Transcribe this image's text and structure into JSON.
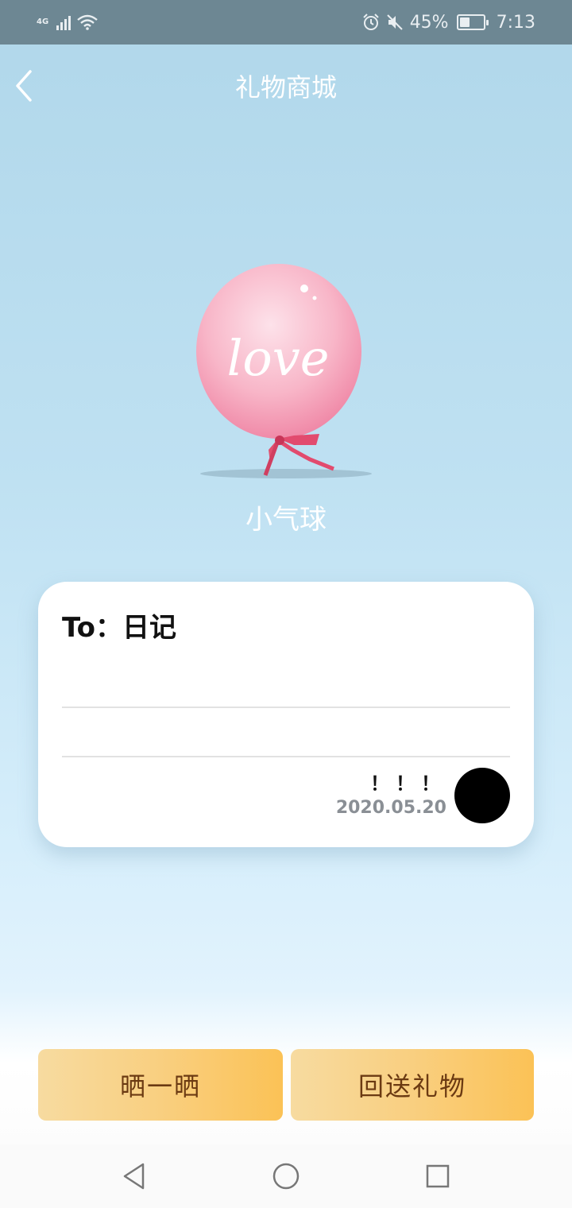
{
  "status_bar": {
    "network": "4G",
    "battery_text": "45%",
    "battery_level": 0.45,
    "time": "7:13",
    "icons": [
      "signal-icon",
      "wifi-icon",
      "alarm-icon",
      "mute-icon",
      "battery-icon"
    ]
  },
  "header": {
    "title": "礼物商城",
    "back_icon": "chevron-left-icon"
  },
  "gift": {
    "name": "小气球",
    "image_text": "love"
  },
  "card": {
    "to_label": "To：",
    "recipient": "日记",
    "signature": "！！！",
    "date": "2020.05.20"
  },
  "actions": {
    "share_label": "晒一晒",
    "return_gift_label": "回送礼物"
  },
  "colors": {
    "accent_gold": "#fbc256",
    "button_text": "#6b3a12",
    "background_blue": "#b0d7ea"
  },
  "system_nav": {
    "icons": [
      "back-triangle-icon",
      "home-circle-icon",
      "recents-square-icon"
    ]
  }
}
